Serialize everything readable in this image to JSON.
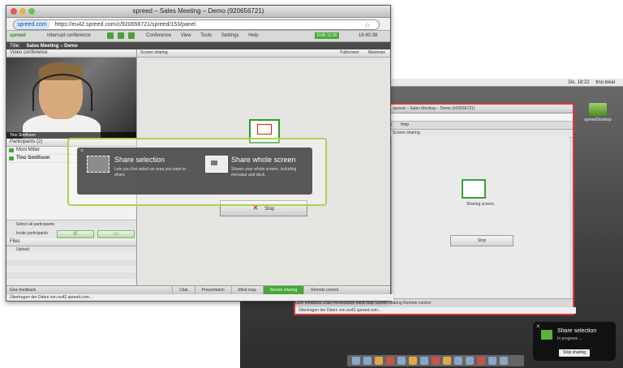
{
  "desktop": {
    "menubar": [
      "Do. 18:22",
      "tino.lokal"
    ],
    "drive_label": "spreedDesktop"
  },
  "right_window": {
    "title": "spreed – Sales Meeting – Demo (920656721)",
    "url": "42/721/spreed/153/panel",
    "menu": "Conference View Tools Settings Help",
    "panel_header": "Screen sharing",
    "status_text": "Sharing screen.",
    "stop_label": "Stop",
    "tabs": "Give feedback   Chat   Presentation   Mind map   Screen sharing   Remote control",
    "statusbar": "Übertragen der Daten von eu42.spreed.com..."
  },
  "notification": {
    "title": "Share selection",
    "subtitle": "In progress ...",
    "button": "Stop sharing"
  },
  "main": {
    "window_title": "spreed – Sales Meeting – Demo (920656721)",
    "url_site": "spreed.com",
    "url": "https://eu42.spreed.com/c/920656721/spreed/153/panel",
    "toolbar": {
      "logo": "spreed",
      "interrupt": "Interrupt conference",
      "menus": [
        "Conference",
        "View",
        "Tools",
        "Settings",
        "Help"
      ],
      "credit": "EUR 12.00",
      "time": "16:40:38"
    },
    "title_label": "Title:",
    "title_value": "Sales Meeting – Demo",
    "video_header": "Video conference",
    "video_name": "Tino Smithson",
    "participants_header": "Participants (2)",
    "participants": [
      "Moni Miller",
      "Tino Smithson"
    ],
    "select_all": "Select all participants",
    "invite": "Invite participants",
    "files_header": "Files",
    "upload": "Upload",
    "content_header": "Screen sharing",
    "fullscreen": "Fullscreen",
    "maximize": "Maximize",
    "stop_label": "Stop",
    "feedback": "Give feedback",
    "tabs": [
      "Chat",
      "Presentation",
      "Mind map",
      "Screen sharing",
      "Remote control"
    ],
    "statusbar": "Übertragen der Daten von eu42.spreed.com..."
  },
  "popup": {
    "option1_title": "Share selection",
    "option1_desc": "Lets you first select an area you want to share.",
    "option2_title": "Share whole screen",
    "option2_desc": "Shares your whole screen, including menubar and dock."
  },
  "colors": {
    "accent": "#45a837",
    "highlight": "#d9363a"
  }
}
